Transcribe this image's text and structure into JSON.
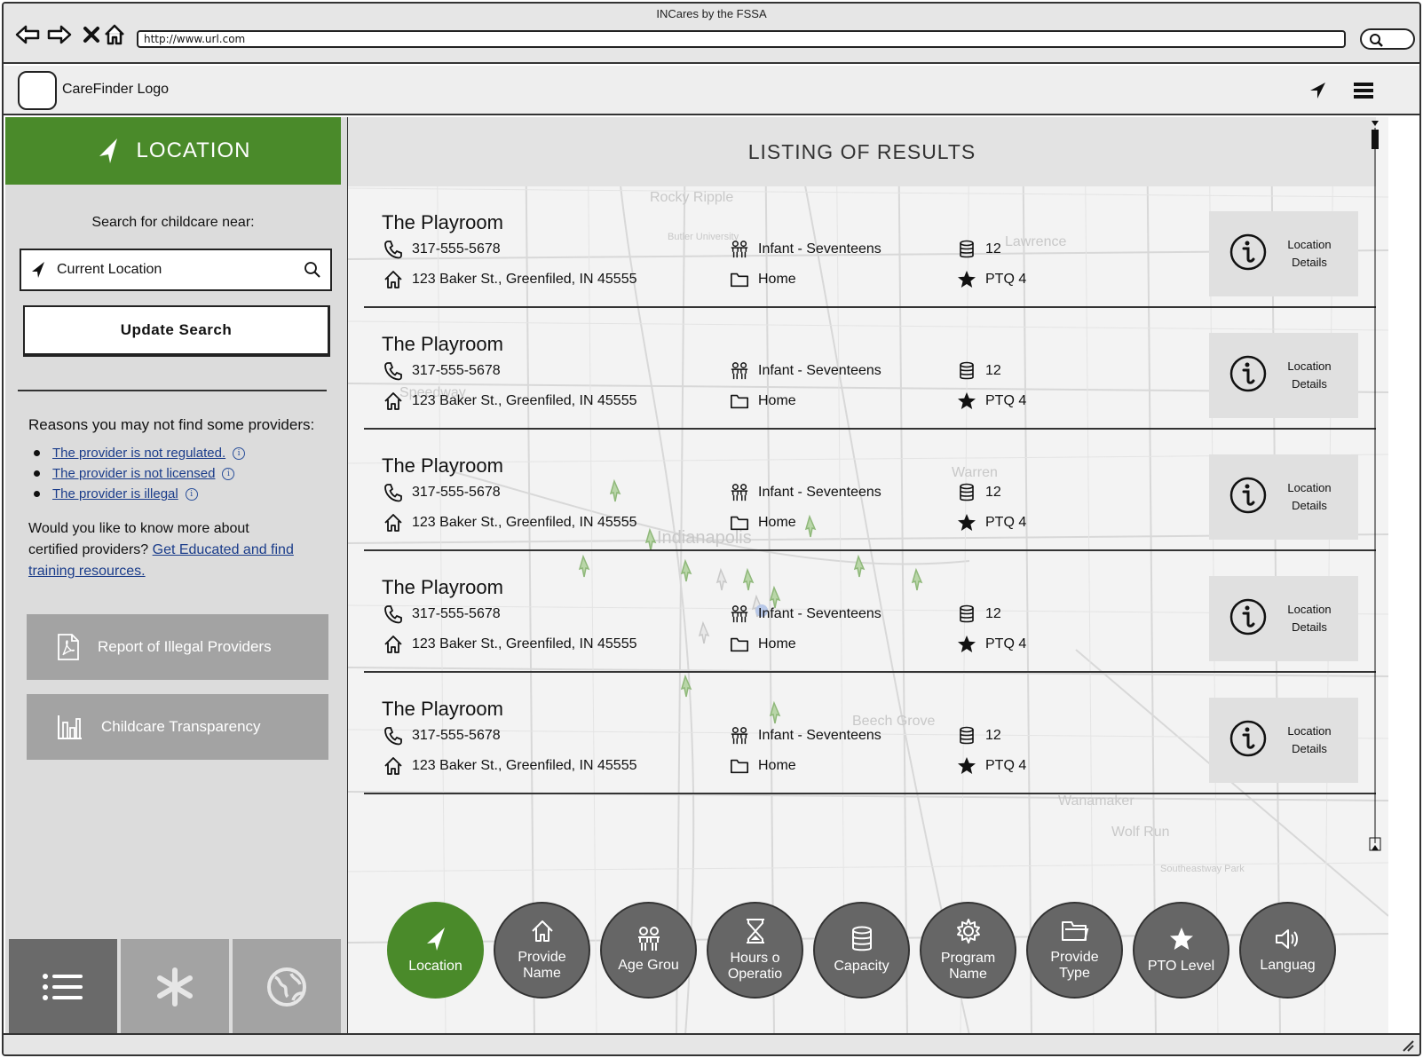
{
  "window": {
    "title": "INCares by the FSSA",
    "url": "http://www.url.com"
  },
  "header": {
    "logo_text": "CareFinder Logo"
  },
  "sidebar": {
    "location_heading": "LOCATION",
    "search_prompt": "Search for childcare near:",
    "location_value": "Current Location",
    "update_button": "Update Search",
    "reasons_title": "Reasons you may not find some providers:",
    "reasons": [
      "The provider is not regulated.",
      "The provider is not licensed",
      "The provider is illegal"
    ],
    "more_text": "Would you like to know more about certified providers?",
    "more_link": "Get Educated and find training resources.",
    "report_button": "Report of Illegal Providers",
    "transparency_button": "Childcare Transparency"
  },
  "main": {
    "results_heading": "LISTING OF RESULTS",
    "results": [
      {
        "name": "The Playroom",
        "phone": "317-555-5678",
        "address": "123 Baker St., Greenfiled, IN 45555",
        "age": "Infant - Seventeens",
        "type": "Home",
        "capacity": "12",
        "ptq": "PTQ 4",
        "details_label_1": "Location",
        "details_label_2": "Details"
      },
      {
        "name": "The Playroom",
        "phone": "317-555-5678",
        "address": "123 Baker St., Greenfiled, IN 45555",
        "age": "Infant - Seventeens",
        "type": "Home",
        "capacity": "12",
        "ptq": "PTQ 4",
        "details_label_1": "Location",
        "details_label_2": "Details"
      },
      {
        "name": "The Playroom",
        "phone": "317-555-5678",
        "address": "123 Baker St., Greenfiled, IN 45555",
        "age": "Infant - Seventeens",
        "type": "Home",
        "capacity": "12",
        "ptq": "PTQ 4",
        "details_label_1": "Location",
        "details_label_2": "Details"
      },
      {
        "name": "The Playroom",
        "phone": "317-555-5678",
        "address": "123 Baker St., Greenfiled, IN 45555",
        "age": "Infant - Seventeens",
        "type": "Home",
        "capacity": "12",
        "ptq": "PTQ 4",
        "details_label_1": "Location",
        "details_label_2": "Details"
      },
      {
        "name": "The Playroom",
        "phone": "317-555-5678",
        "address": "123 Baker St., Greenfiled, IN 45555",
        "age": "Infant - Seventeens",
        "type": "Home",
        "capacity": "12",
        "ptq": "PTQ 4",
        "details_label_1": "Location",
        "details_label_2": "Details"
      }
    ],
    "map_labels": [
      "Rocky Ripple",
      "Butler University",
      "Lawrence",
      "Speedway",
      "Indianapolis",
      "Warren",
      "Beech Grove",
      "Wanamaker",
      "Wolf Run",
      "Southeastway Park"
    ],
    "filters": [
      {
        "label": "Location",
        "icon": "location-arrow-icon",
        "active": true
      },
      {
        "label": "Provide Name",
        "icon": "home-icon",
        "active": false
      },
      {
        "label": "Age Grou",
        "icon": "children-icon",
        "active": false
      },
      {
        "label": "Hours o Operatio",
        "icon": "hourglass-icon",
        "active": false
      },
      {
        "label": "Capacity",
        "icon": "database-icon",
        "active": false
      },
      {
        "label": "Program Name",
        "icon": "gear-icon",
        "active": false
      },
      {
        "label": "Provide Type",
        "icon": "folder-icon",
        "active": false
      },
      {
        "label": "PTO Level",
        "icon": "star-icon",
        "active": false
      },
      {
        "label": "Languag",
        "icon": "speaker-icon",
        "active": false
      }
    ]
  },
  "colors": {
    "accent_green": "#4a8a2a",
    "filter_gray": "#666666",
    "button_gray": "#a3a3a3",
    "link_blue": "#1a3c8a"
  }
}
